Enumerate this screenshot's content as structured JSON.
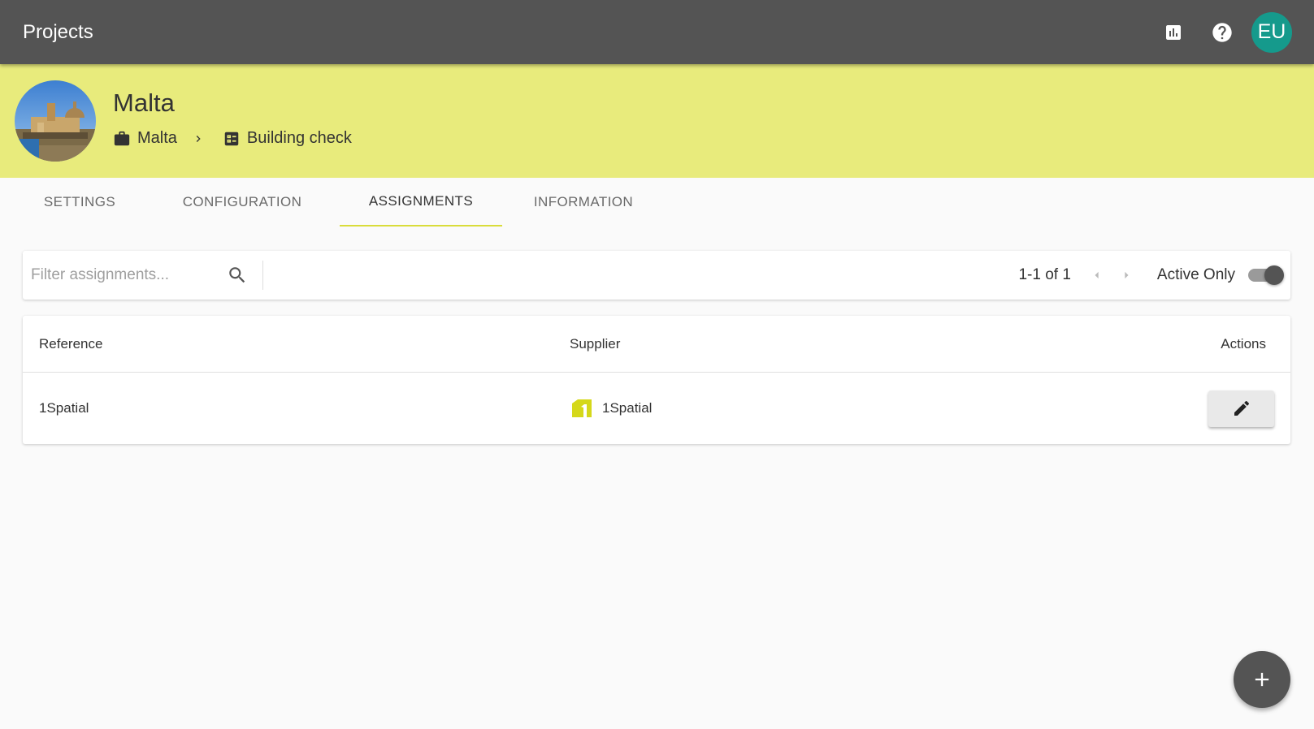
{
  "appbar": {
    "title": "Projects",
    "icons": [
      "bar-chart-icon",
      "help-icon"
    ],
    "user_initials": "EU",
    "user_color": "#159a8c",
    "color": "#545454"
  },
  "project": {
    "name": "Malta",
    "banner_color": "#e8eb7c",
    "breadcrumb": [
      {
        "label": "Malta",
        "icon": "briefcase-icon"
      },
      {
        "label": "Building check",
        "icon": "checklist-icon"
      }
    ]
  },
  "tabs": [
    {
      "label": "SETTINGS",
      "active": false
    },
    {
      "label": "CONFIGURATION",
      "active": false
    },
    {
      "label": "ASSIGNMENTS",
      "active": true
    },
    {
      "label": "INFORMATION",
      "active": false
    }
  ],
  "toolbar": {
    "filter_placeholder": "Filter assignments...",
    "filter_value": "",
    "pager": "1-1 of 1",
    "active_only_label": "Active Only",
    "active_only": true
  },
  "table": {
    "headers": {
      "reference": "Reference",
      "supplier": "Supplier",
      "actions": "Actions"
    },
    "rows": [
      {
        "reference": "1Spatial",
        "supplier": "1Spatial",
        "supplier_logo": "1spatial-logo",
        "action": "edit-icon"
      }
    ]
  },
  "fab": {
    "icon": "plus-icon"
  }
}
